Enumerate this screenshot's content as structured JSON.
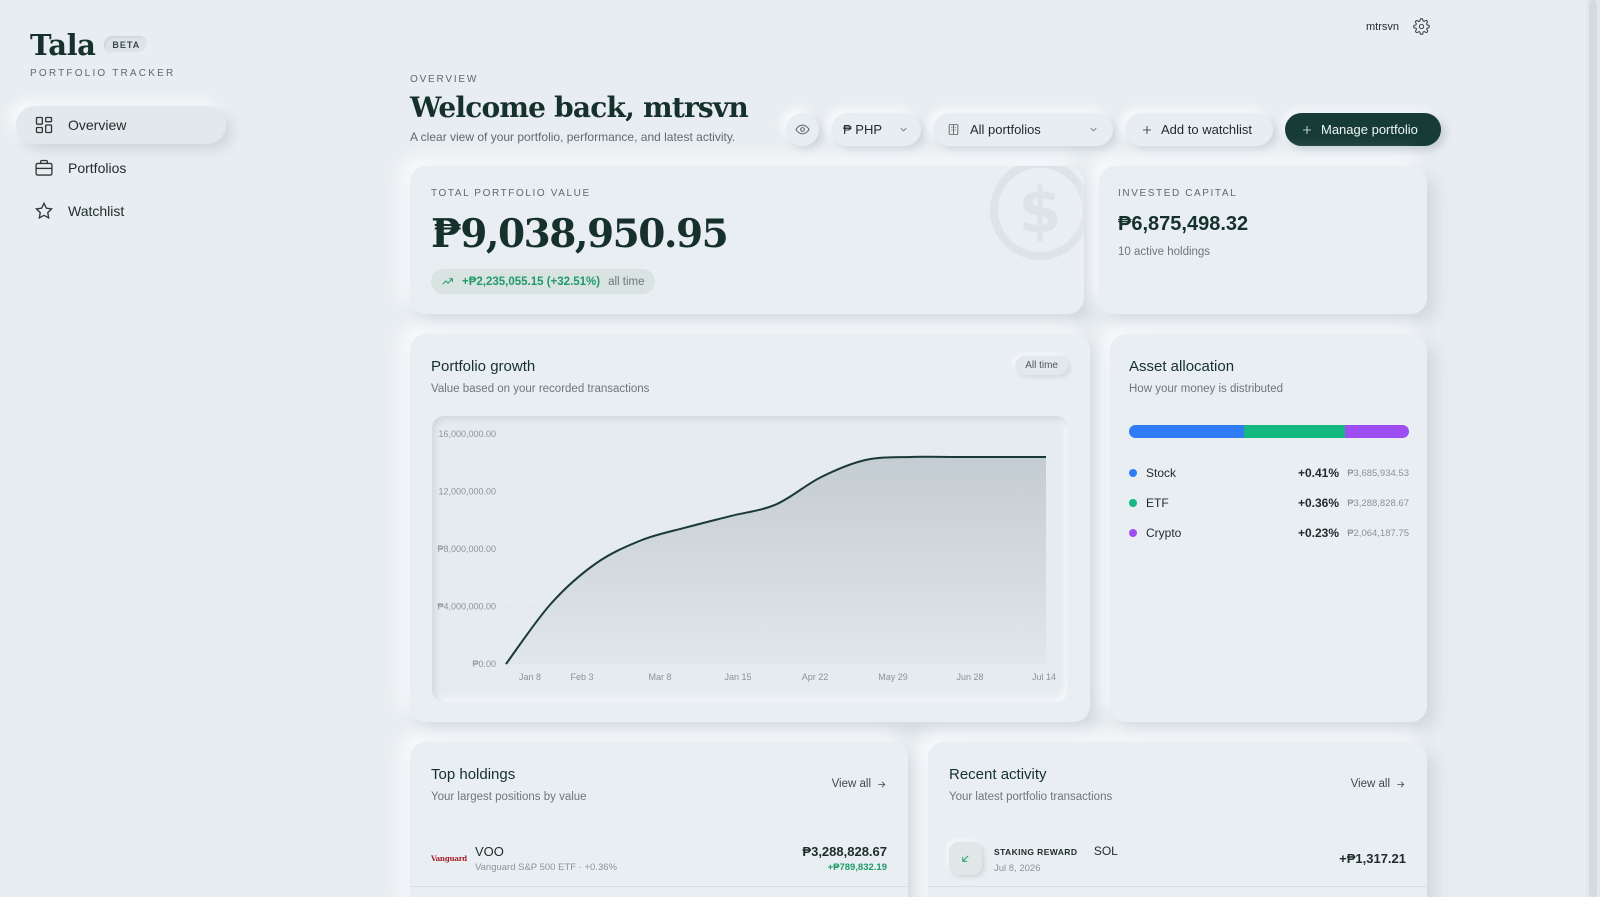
{
  "brand": {
    "name": "Tala",
    "badge": "BETA",
    "subtitle": "PORTFOLIO TRACKER"
  },
  "nav": [
    {
      "label": "Overview",
      "icon": "grid-icon",
      "active": true
    },
    {
      "label": "Portfolios",
      "icon": "briefcase-icon",
      "active": false
    },
    {
      "label": "Watchlist",
      "icon": "star-icon",
      "active": false
    }
  ],
  "user": {
    "name": "mtrsvn"
  },
  "header": {
    "eyebrow": "OVERVIEW",
    "title": "Welcome back, mtrsvn",
    "subtitle": "A clear view of your portfolio, performance, and latest activity."
  },
  "controls": {
    "currency": "₱ PHP",
    "portfolio": "All portfolios",
    "watchlist_label": "Add to watchlist",
    "manage_label": "Manage portfolio"
  },
  "total": {
    "label": "TOTAL PORTFOLIO VALUE",
    "value": "₱9,038,950.95",
    "change": "+₱2,235,055.15 (+32.51%)",
    "period": "all time"
  },
  "invested": {
    "label": "INVESTED CAPITAL",
    "value": "₱6,875,498.32",
    "holdings": "10 active holdings"
  },
  "growth": {
    "title": "Portfolio growth",
    "subtitle": "Value based on your recorded transactions",
    "range": "All time"
  },
  "chart_data": {
    "type": "area",
    "x_labels": [
      "Jan 8",
      "Feb 3",
      "Mar 8",
      "Jan 15",
      "Apr 22",
      "May 29",
      "Jun 28",
      "Jul 14"
    ],
    "y_ticks": [
      "16,000,000.00",
      "12,000,000.00",
      "₱8,000,000.00",
      "₱4,000,000.00",
      "₱0.00"
    ],
    "ylim": [
      0,
      16000000
    ],
    "y_tick_values": [
      16000000,
      12000000,
      8000000,
      4000000,
      0
    ],
    "values": [
      0,
      4200000,
      7000000,
      8600000,
      9500000,
      10300000,
      11100000,
      13000000,
      14200000,
      14400000,
      14400000,
      14400000,
      14400000
    ],
    "grid": true,
    "colors": {
      "line": "#1b3a35",
      "fill": "#c2cbd1"
    }
  },
  "allocation": {
    "title": "Asset allocation",
    "subtitle": "How your money is distributed",
    "items": [
      {
        "name": "Stock",
        "pct": "+0.41%",
        "amount": "₱3,685,934.53",
        "share": 0.41,
        "color": "#2f7cf6"
      },
      {
        "name": "ETF",
        "pct": "+0.36%",
        "amount": "₱3,288,828.67",
        "share": 0.36,
        "color": "#13b981"
      },
      {
        "name": "Crypto",
        "pct": "+0.23%",
        "amount": "₱2,064,187.75",
        "share": 0.23,
        "color": "#9d4df2"
      }
    ]
  },
  "top_holdings": {
    "title": "Top holdings",
    "subtitle": "Your largest positions by value",
    "view_all": "View all",
    "rows": [
      {
        "logo": "Vanguard",
        "ticker": "VOO",
        "meta": "Vanguard S&P 500 ETF · +0.36%",
        "value": "₱3,288,828.67",
        "gain": "+₱789,832.19"
      }
    ]
  },
  "recent_activity": {
    "title": "Recent activity",
    "subtitle": "Your latest portfolio transactions",
    "view_all": "View all",
    "rows": [
      {
        "type": "STAKING REWARD",
        "symbol": "SOL",
        "date": "Jul 8, 2026",
        "amount": "+₱1,317.21"
      }
    ]
  }
}
